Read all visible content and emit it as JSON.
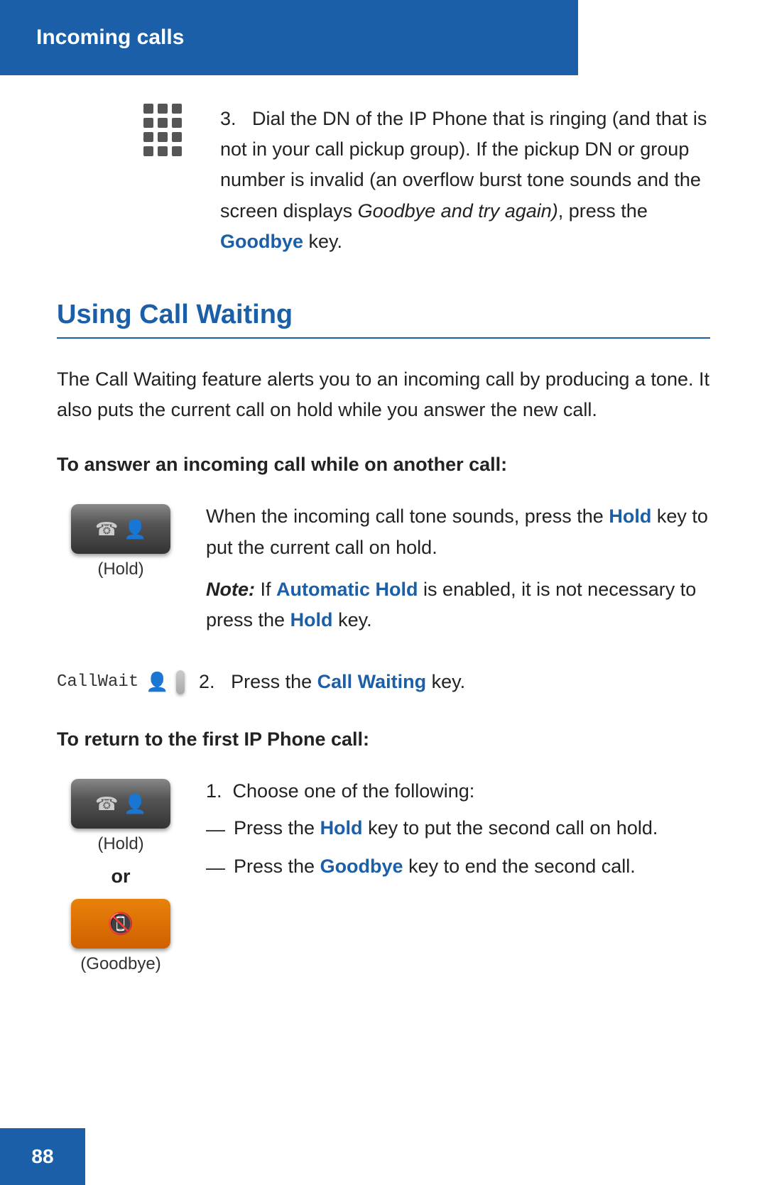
{
  "header": {
    "title": "Incoming calls",
    "bg_color": "#1a5fa8"
  },
  "step3": {
    "number": "3.",
    "text": "Dial the DN of the IP Phone that is ringing (and that is not in your call pickup group). If the pickup DN or group number is invalid (an overflow burst tone sounds and the screen displays ",
    "italic_part": "Goodbye and try again)",
    "text_after_italic": ", press the ",
    "link_text": "Goodbye",
    "text_end": " key."
  },
  "section_title": "Using Call Waiting",
  "section_intro": "The Call Waiting feature alerts you to an incoming call by producing a tone. It also puts the current call on hold while you answer the new call.",
  "answer_subheading": "To answer an incoming call while on another call:",
  "answer_steps": {
    "hold_label": "(Hold)",
    "step1_text": "When the incoming call tone sounds, press the ",
    "step1_link": "Hold",
    "step1_text2": " key to put the current call on hold.",
    "note_bold": "Note:",
    "note_link": "Automatic Hold",
    "note_text": " is enabled, it is not necessary to press the ",
    "note_link2": "Hold",
    "note_text2": " key."
  },
  "callwait_step": {
    "label": "CallWait",
    "step_number": "2.",
    "text": "Press the ",
    "link": "Call Waiting",
    "text2": " key."
  },
  "return_subheading": "To return to the first IP Phone call:",
  "return_steps": {
    "hold_label": "(Hold)",
    "or_label": "or",
    "goodbye_label": "(Goodbye)",
    "step1_intro": "Choose one of the following:",
    "bullet1_text": "Press the ",
    "bullet1_link": "Hold",
    "bullet1_text2": " key to put the second call on hold.",
    "bullet2_text": "Press the ",
    "bullet2_link": "Goodbye",
    "bullet2_text2": " key to end the second call."
  },
  "page_number": "88",
  "colors": {
    "blue": "#1a5fa8",
    "orange": "#d06000",
    "text": "#222222",
    "white": "#ffffff"
  }
}
